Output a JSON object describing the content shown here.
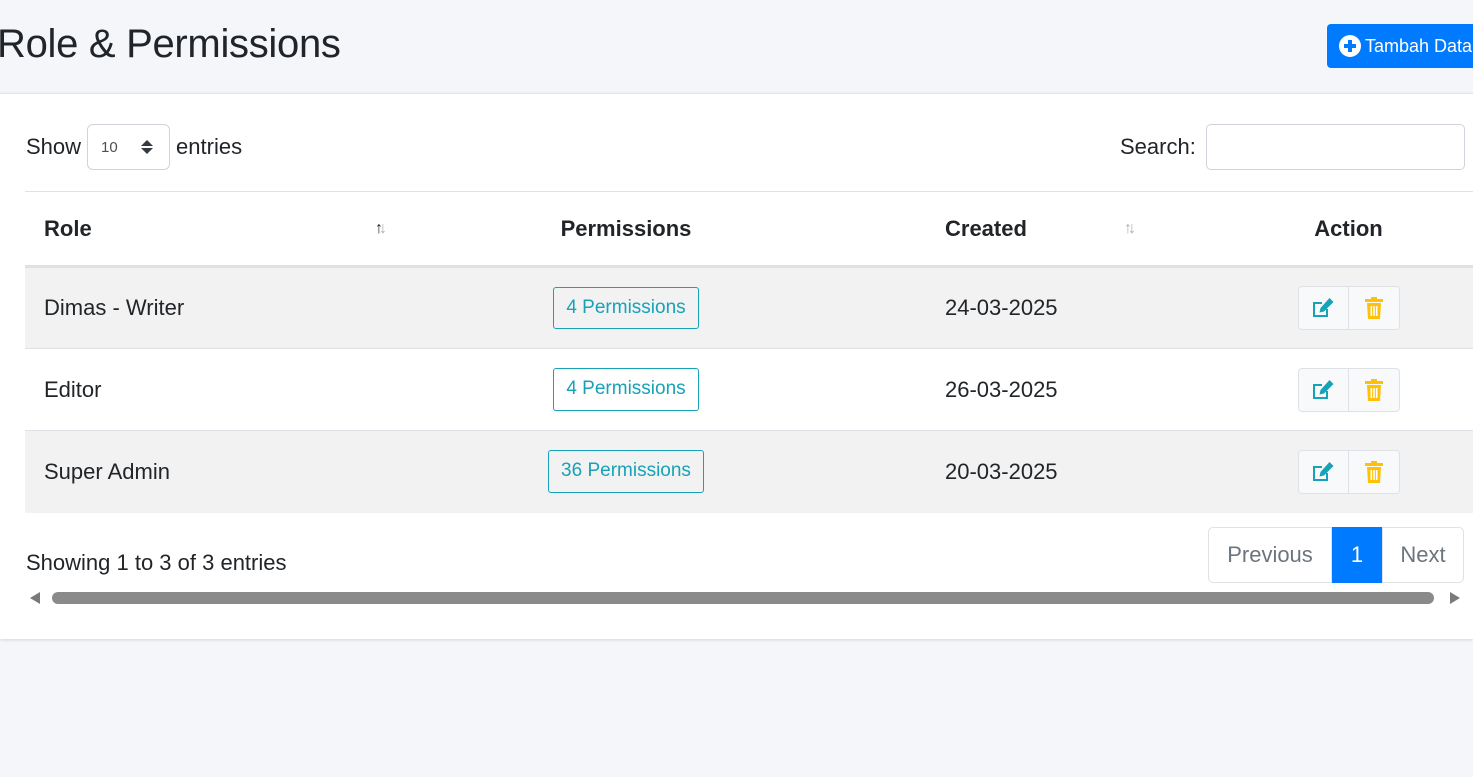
{
  "header": {
    "title": "Role & Permissions",
    "add_button_label": "Tambah Data"
  },
  "table_controls": {
    "show_label": "Show",
    "entries_label": "entries",
    "page_length": "10",
    "search_label": "Search:",
    "search_value": ""
  },
  "table": {
    "columns": [
      "Role",
      "Permissions",
      "Created",
      "Action"
    ],
    "rows": [
      {
        "role": "Dimas - Writer",
        "permissions": "4 Permissions",
        "created": "24-03-2025"
      },
      {
        "role": "Editor",
        "permissions": "4 Permissions",
        "created": "26-03-2025"
      },
      {
        "role": "Super Admin",
        "permissions": "36 Permissions",
        "created": "20-03-2025"
      }
    ]
  },
  "footer": {
    "info": "Showing 1 to 3 of 3 entries",
    "prev_label": "Previous",
    "current_page": "1",
    "next_label": "Next"
  },
  "colors": {
    "primary": "#007bff",
    "info": "#17a2b8",
    "warning": "#ffc107"
  }
}
